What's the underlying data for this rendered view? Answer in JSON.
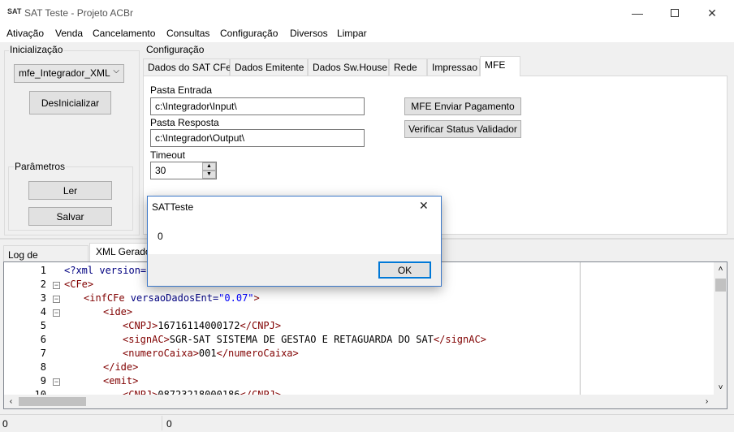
{
  "window": {
    "title": "SAT Teste - Projeto ACBr",
    "icon_label": "SAT"
  },
  "menu": [
    "Ativação",
    "Venda",
    "Cancelamento",
    "Consultas",
    "Configuração",
    "Diversos",
    "Limpar"
  ],
  "init": {
    "group_label": "Inicialização",
    "model_select_value": "mfe_Integrador_XML",
    "deinit_button": "DesInicializar",
    "params_label": "Parâmetros",
    "read_button": "Ler",
    "save_button": "Salvar"
  },
  "config": {
    "group_label": "Configuração",
    "tabs": [
      "Dados do SAT CFe",
      "Dados Emitente",
      "Dados Sw.House",
      "Rede",
      "Impressao",
      "MFE"
    ],
    "active_tab": "MFE",
    "pasta_entrada_label": "Pasta Entrada",
    "pasta_entrada_value": "c:\\Integrador\\Input\\",
    "pasta_resposta_label": "Pasta Resposta",
    "pasta_resposta_value": "c:\\Integrador\\Output\\",
    "timeout_label": "Timeout",
    "timeout_value": "30",
    "send_payment_button": "MFE Enviar Pagamento",
    "verify_status_button": "Verificar Status Validador"
  },
  "bottom_tabs": [
    "Log de Comandos",
    "XML Gerado"
  ],
  "editor": {
    "line_numbers": [
      "1",
      "2",
      "3",
      "4",
      "5",
      "6",
      "7",
      "8",
      "9",
      "10"
    ],
    "lines": [
      {
        "indent": 0,
        "parts": [
          [
            "pi",
            "<?xml version="
          ]
        ]
      },
      {
        "indent": 0,
        "parts": [
          [
            "tag",
            "<CFe>"
          ]
        ]
      },
      {
        "indent": 1,
        "parts": [
          [
            "tag",
            "<infCFe "
          ],
          [
            "attr",
            "versaoDadosEnt="
          ],
          [
            "val",
            "\"0.07\""
          ],
          [
            "tag",
            ">"
          ]
        ]
      },
      {
        "indent": 2,
        "parts": [
          [
            "tag",
            "<ide>"
          ]
        ]
      },
      {
        "indent": 3,
        "parts": [
          [
            "tag",
            "<CNPJ>"
          ],
          [
            "plain",
            "16716114000172"
          ],
          [
            "tag",
            "</CNPJ>"
          ]
        ]
      },
      {
        "indent": 3,
        "parts": [
          [
            "tag",
            "<signAC>"
          ],
          [
            "plain",
            "SGR-SAT SISTEMA DE GESTAO E RETAGUARDA DO SAT"
          ],
          [
            "tag",
            "</signAC>"
          ]
        ]
      },
      {
        "indent": 3,
        "parts": [
          [
            "tag",
            "<numeroCaixa>"
          ],
          [
            "plain",
            "001"
          ],
          [
            "tag",
            "</numeroCaixa>"
          ]
        ]
      },
      {
        "indent": 2,
        "parts": [
          [
            "tag",
            "</ide>"
          ]
        ]
      },
      {
        "indent": 2,
        "parts": [
          [
            "tag",
            "<emit>"
          ]
        ]
      },
      {
        "indent": 3,
        "parts": [
          [
            "tag",
            "<CNPJ>"
          ],
          [
            "plain",
            "08723218000186"
          ],
          [
            "tag",
            "</CNPJ>"
          ]
        ]
      }
    ]
  },
  "status": {
    "left": "0",
    "right": "0"
  },
  "dialog": {
    "title": "SATTeste",
    "message": "0",
    "ok_button": "OK"
  }
}
